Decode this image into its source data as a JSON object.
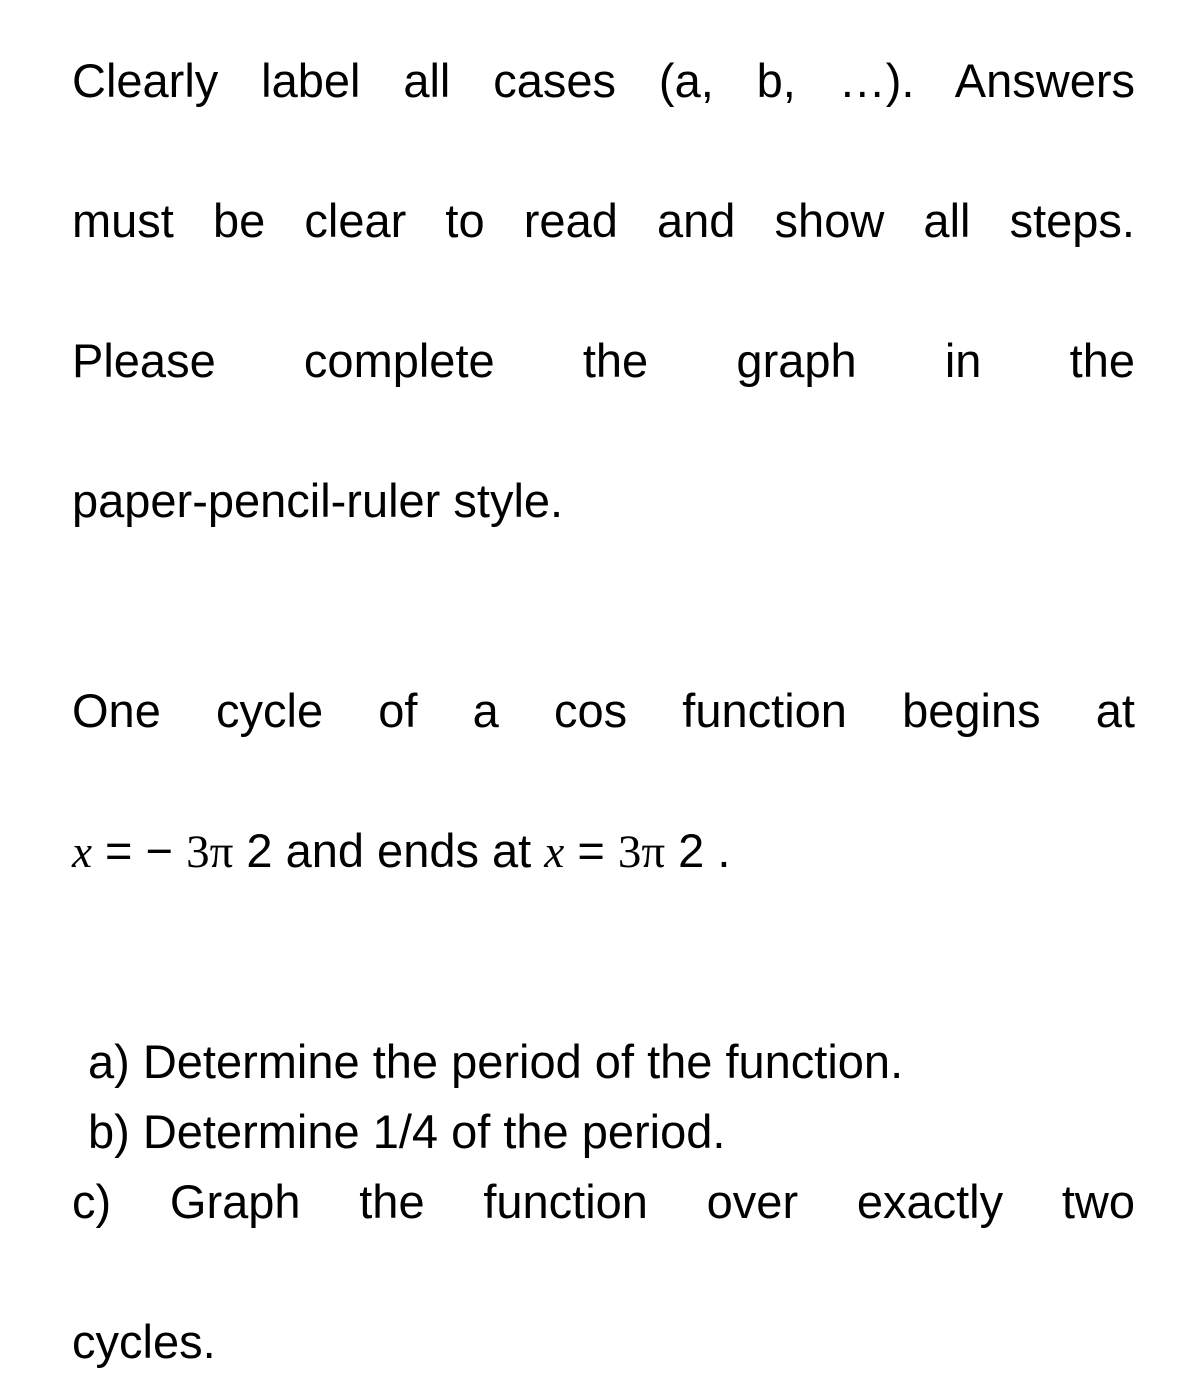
{
  "document": {
    "background_color": "#ffffff",
    "text_color": "#000000",
    "type": "math-worksheet-question"
  },
  "instructions": {
    "line1": "Clearly label all cases (a, b, …). Answers",
    "line2": "must be clear to read and show all steps.",
    "line3": "Please complete the graph in the",
    "line4": "paper-pencil-ruler style."
  },
  "problem": {
    "line1": "One cycle of a cos function begins at",
    "math_line": {
      "var1": "x",
      "equals1": "=",
      "minus": "−",
      "three_pi_1": "3π",
      "denom1": "2",
      "connector": "and ends at",
      "var2": "x",
      "equals2": "=",
      "three_pi_2": "3π",
      "denom2": "2",
      "period": "."
    }
  },
  "tasks": {
    "a": "a) Determine the period of the function.",
    "b": "b) Determine 1/4 of the period.",
    "c_line1": "c) Graph the function over exactly two",
    "c_line2": "cycles."
  }
}
